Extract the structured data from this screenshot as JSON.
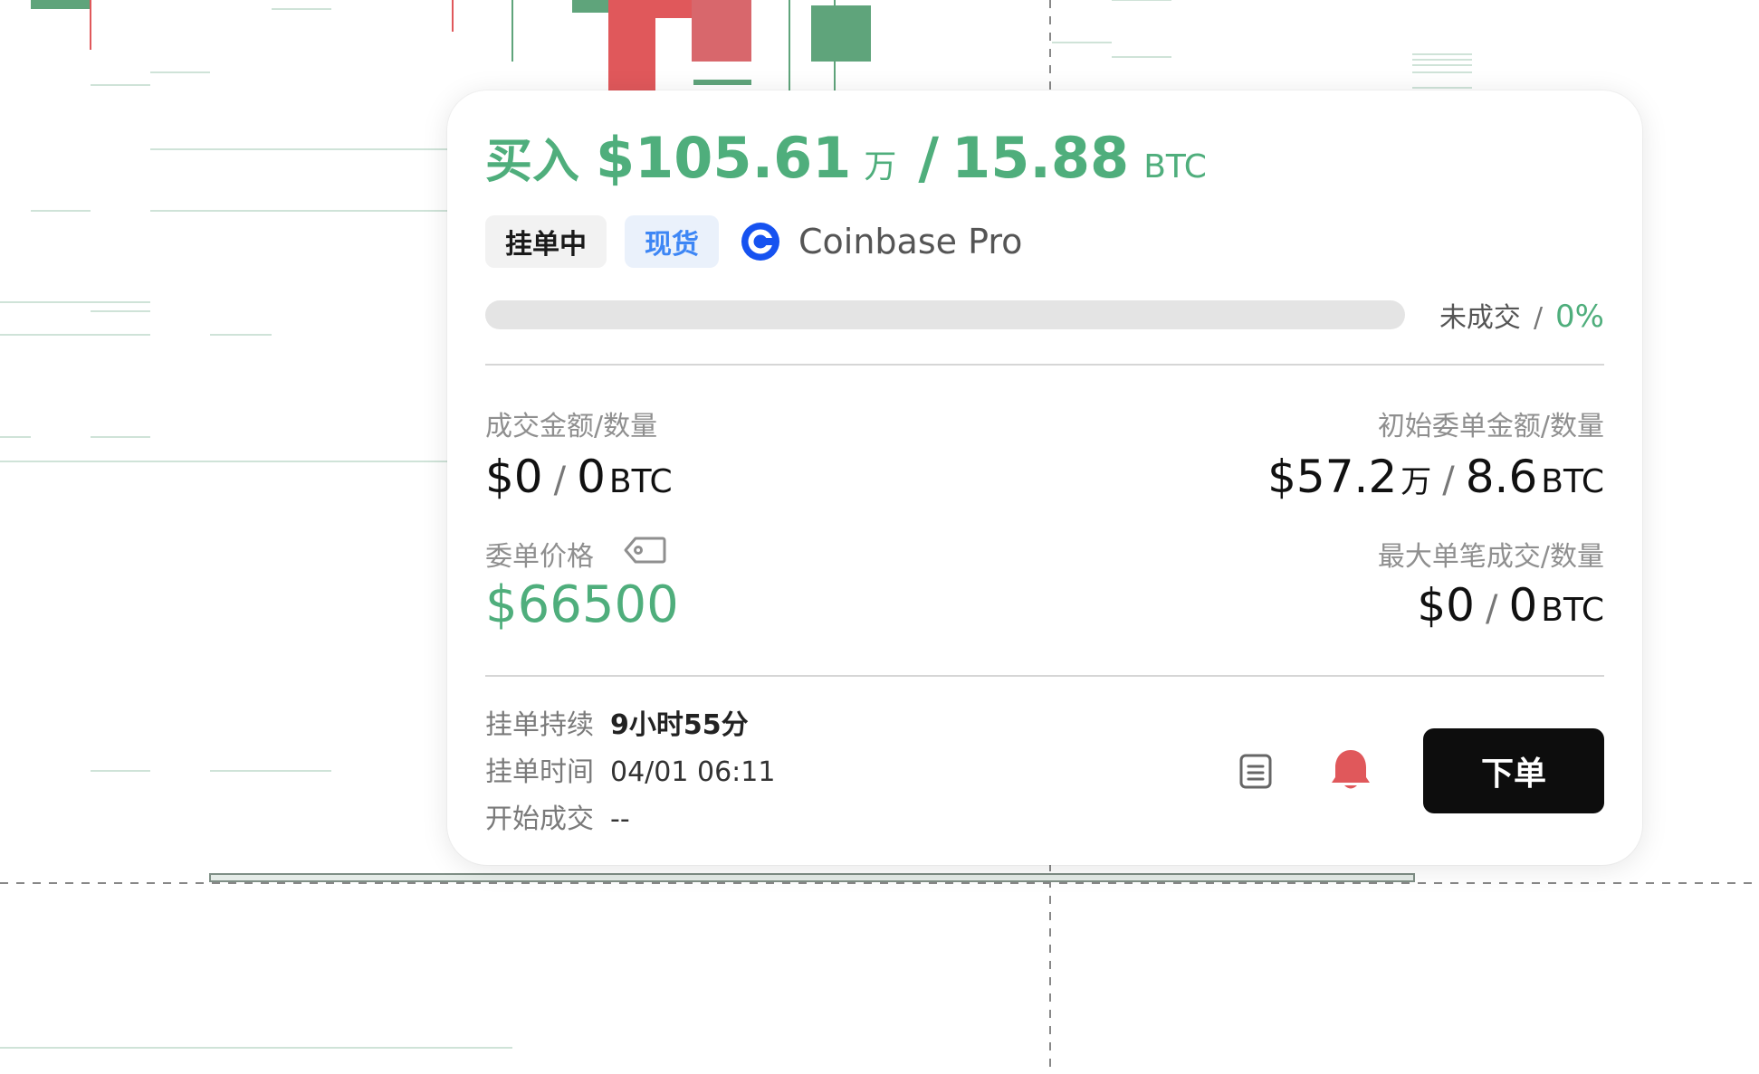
{
  "order": {
    "side": "买入",
    "amount": "$105.61",
    "amount_unit": "万",
    "slash": "/",
    "quantity": "15.88",
    "quantity_unit": "BTC",
    "status_tag": "挂单中",
    "market_tag": "现货",
    "exchange": "Coinbase Pro",
    "fill_label": "未成交",
    "fill_sep": "/",
    "fill_percent": "0%",
    "fill_fraction": 0
  },
  "stats": {
    "filled_label": "成交金额/数量",
    "filled_amount": "$0",
    "filled_sep": "/",
    "filled_qty": "0",
    "filled_unit": "BTC",
    "initial_label": "初始委单金额/数量",
    "initial_amount": "$57.2",
    "initial_wan": "万",
    "initial_sep": "/",
    "initial_qty": "8.6",
    "initial_unit": "BTC",
    "price_label": "委单价格",
    "price": "$66500",
    "max_label": "最大单笔成交/数量",
    "max_amount": "$0",
    "max_sep": "/",
    "max_qty": "0",
    "max_unit": "BTC"
  },
  "footer": {
    "duration_label": "挂单持续",
    "duration": "9小时55分",
    "time_label": "挂单时间",
    "time": "04/01 06:11",
    "start_label": "开始成交",
    "start": "--",
    "order_button": "下单"
  },
  "colors": {
    "buy_green": "#4fae7c",
    "sell_red": "#e0585b",
    "market_blue": "#3d86f5",
    "coinbase_blue": "#1652f0"
  },
  "icons": [
    "coinbase-logo-icon",
    "price-tag-icon",
    "clipboard-icon",
    "bell-icon"
  ]
}
